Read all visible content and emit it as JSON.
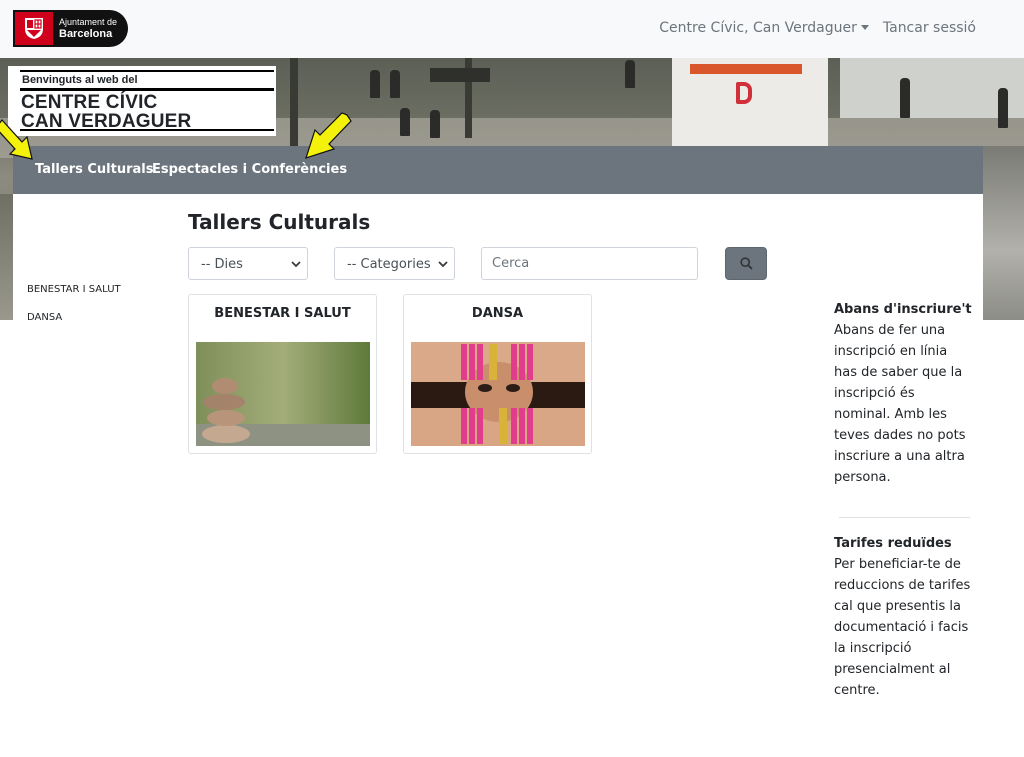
{
  "header": {
    "logo_small": "Ajuntament de",
    "logo_big": "Barcelona",
    "center_menu": "Centre Cívic, Can Verdaguer",
    "logout": "Tancar sessió"
  },
  "hero": {
    "welcome": "Benvinguts al web del",
    "center_line1": "CENTRE CÍVIC",
    "center_line2": "CAN VERDAGUER"
  },
  "section_nav": {
    "items": [
      "Tallers Culturals",
      "Espectacles i Conferències"
    ]
  },
  "sidebar": {
    "items": [
      "BENESTAR I SALUT",
      "DANSA"
    ]
  },
  "main": {
    "title": "Tallers Culturals",
    "filters": {
      "days": "-- Dies",
      "categories": "-- Categories",
      "search_placeholder": "Cerca"
    },
    "cards": [
      {
        "title": "BENESTAR I SALUT"
      },
      {
        "title": "DANSA"
      }
    ]
  },
  "info": {
    "before_title": "Abans d'inscriure't",
    "before_text": "Abans de fer una inscripció en línia has de saber que la inscripció és nominal. Amb les teves dades no pots inscriure a una altra persona.",
    "reduced_title": "Tarifes reduïdes",
    "reduced_text": "Per beneficiar-te de reduccions de tarifes cal que presentis la documentació i facis la inscripció presencialment al centre."
  },
  "colors": {
    "nav_bar": "#6c757d",
    "arrow": "#f4f20a",
    "logo_red": "#d0021b"
  }
}
